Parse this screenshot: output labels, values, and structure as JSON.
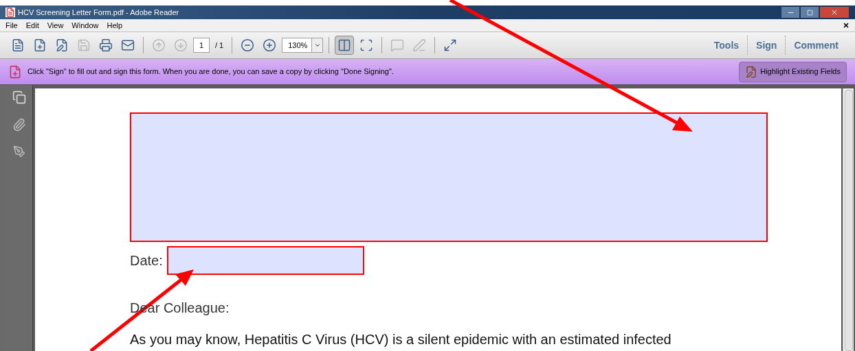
{
  "window": {
    "title": "HCV Screening Letter Form.pdf - Adobe Reader"
  },
  "menu": [
    "File",
    "Edit",
    "View",
    "Window",
    "Help"
  ],
  "toolbar": {
    "page_number": "1",
    "page_total": "/ 1",
    "zoom": "130%",
    "view_buttons": [
      {
        "kind": "fit-width",
        "selected": true
      },
      {
        "kind": "fit-page",
        "selected": false
      }
    ],
    "panes": [
      "Tools",
      "Sign",
      "Comment"
    ]
  },
  "message_bar": {
    "text": "Click \"Sign\" to fill out and sign this form. When you are done, you can save a copy by clicking \"Done Signing\".",
    "button": "Highlight Existing Fields"
  },
  "document": {
    "date_label": "Date:",
    "greeting": "Dear Colleague:",
    "paragraph": "As you may know, Hepatitis C Virus (HCV) is a silent epidemic with an estimated infected"
  }
}
